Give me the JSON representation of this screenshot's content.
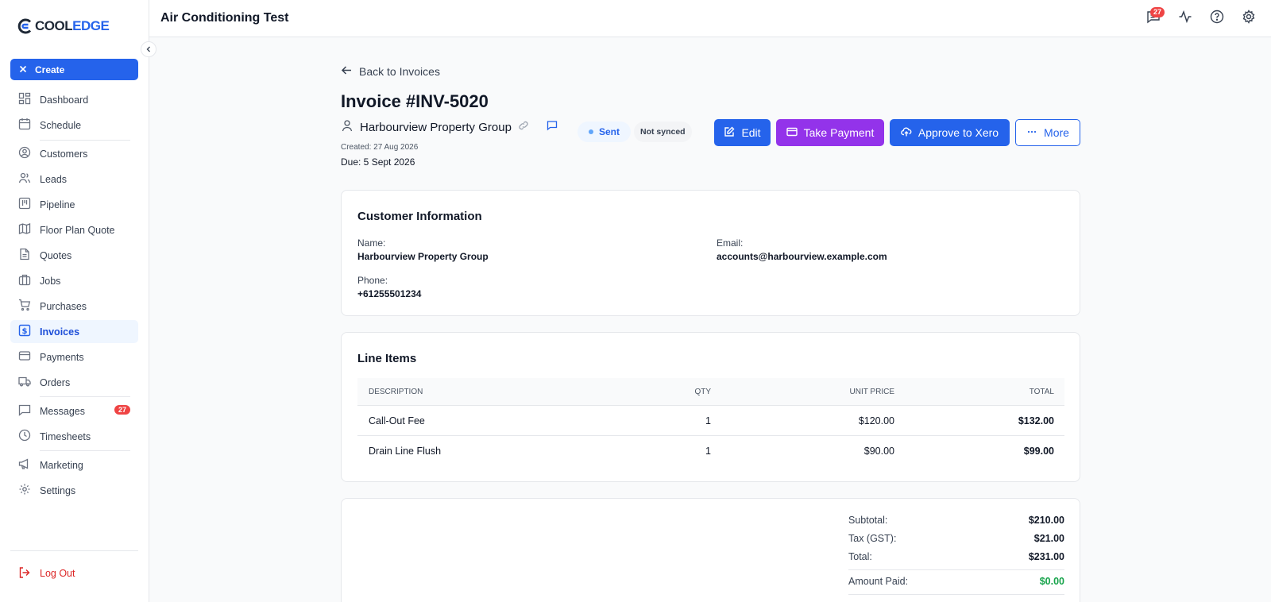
{
  "app": {
    "title": "Air Conditioning Test",
    "notifications_count": "27"
  },
  "logo": {
    "part1": "COOL",
    "part2": "EDGE"
  },
  "sidebar": {
    "create_label": "Create",
    "items": [
      {
        "label": "Dashboard",
        "icon": "dashboard-icon"
      },
      {
        "label": "Schedule",
        "icon": "calendar-icon"
      },
      {
        "label": "Customers",
        "icon": "user-circle-icon"
      },
      {
        "label": "Leads",
        "icon": "users-icon"
      },
      {
        "label": "Pipeline",
        "icon": "kanban-icon"
      },
      {
        "label": "Floor Plan Quote",
        "icon": "map-icon"
      },
      {
        "label": "Quotes",
        "icon": "document-icon"
      },
      {
        "label": "Jobs",
        "icon": "briefcase-icon"
      },
      {
        "label": "Purchases",
        "icon": "cart-icon"
      },
      {
        "label": "Invoices",
        "icon": "invoice-icon"
      },
      {
        "label": "Payments",
        "icon": "credit-card-icon"
      },
      {
        "label": "Orders",
        "icon": "truck-icon"
      },
      {
        "label": "Messages",
        "icon": "message-icon",
        "badge": "27"
      },
      {
        "label": "Timesheets",
        "icon": "clock-icon"
      },
      {
        "label": "Marketing",
        "icon": "megaphone-icon"
      },
      {
        "label": "Settings",
        "icon": "gear-icon"
      }
    ],
    "active": "Invoices",
    "logout_label": "Log Out"
  },
  "invoice": {
    "back_label": "Back to Invoices",
    "title": "Invoice #INV-5020",
    "customer_name": "Harbourview Property Group",
    "status": "Sent",
    "sync_status": "Not synced",
    "created": "Created: 27 Aug 2026",
    "due": "Due: 5 Sept 2026",
    "actions": {
      "edit": "Edit",
      "take_payment": "Take Payment",
      "approve_xero": "Approve to Xero",
      "more": "More"
    }
  },
  "customer_info": {
    "title": "Customer Information",
    "name_label": "Name:",
    "name_value": "Harbourview Property Group",
    "email_label": "Email:",
    "email_value": "accounts@harbourview.example.com",
    "phone_label": "Phone:",
    "phone_value": "+61255501234"
  },
  "line_items": {
    "title": "Line Items",
    "headers": {
      "description": "DESCRIPTION",
      "qty": "QTY",
      "unit_price": "UNIT PRICE",
      "total": "TOTAL"
    },
    "rows": [
      {
        "description": "Call-Out Fee",
        "qty": "1",
        "unit_price": "$120.00",
        "total": "$132.00"
      },
      {
        "description": "Drain Line Flush",
        "qty": "1",
        "unit_price": "$90.00",
        "total": "$99.00"
      }
    ]
  },
  "totals": {
    "subtotal_label": "Subtotal:",
    "subtotal": "$210.00",
    "tax_label": "Tax (GST):",
    "tax": "$21.00",
    "total_label": "Total:",
    "total": "$231.00",
    "paid_label": "Amount Paid:",
    "paid": "$0.00"
  },
  "colors": {
    "primary": "#2563eb",
    "purple": "#9333ea",
    "danger": "#ef4444",
    "success": "#16a34a"
  }
}
